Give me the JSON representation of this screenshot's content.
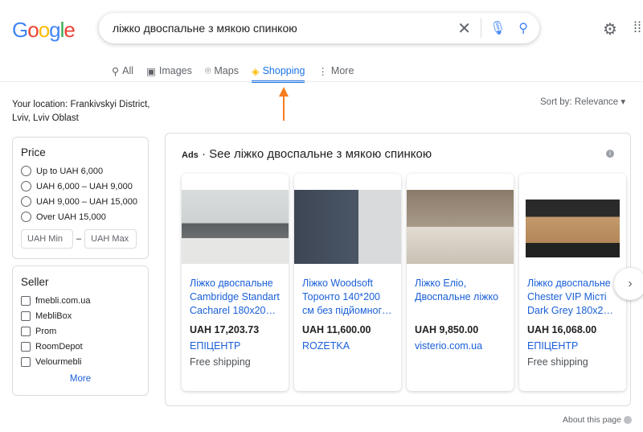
{
  "logo": "Google",
  "search": {
    "query": "ліжко двоспальне з мякою спинкою"
  },
  "tabs": [
    {
      "label": "All",
      "icon": "search-icon"
    },
    {
      "label": "Images",
      "icon": "image-icon"
    },
    {
      "label": "Maps",
      "icon": "map-pin-icon"
    },
    {
      "label": "Shopping",
      "icon": "tag-icon",
      "active": true
    },
    {
      "label": "More",
      "icon": "more-vert-icon"
    }
  ],
  "location": {
    "line1": "Your location: Frankivskyi District,",
    "line2": "Lviv, Lviv Oblast"
  },
  "sort": {
    "label": "Sort by: Relevance"
  },
  "price": {
    "title": "Price",
    "options": [
      "Up to UAH 6,000",
      "UAH 6,000 – UAH 9,000",
      "UAH 9,000 – UAH 15,000",
      "Over UAH 15,000"
    ],
    "min_placeholder": "UAH Min",
    "dash": "–",
    "max_placeholder": "UAH Max"
  },
  "seller": {
    "title": "Seller",
    "options": [
      "fmebli.com.ua",
      "MebliBox",
      "Prom",
      "RoomDepot",
      "Velourmebli"
    ],
    "more": "More"
  },
  "ads": {
    "badge": "Ads",
    "title": "· See ліжко двоспальне з мякою спинкою",
    "info": "i",
    "products": [
      {
        "title": "Ліжко двоспальне Cambridge Standart Cacharel 180x20…",
        "price": "UAH 17,203.73",
        "store": "ЕПІЦЕНТР",
        "shipping": "Free shipping"
      },
      {
        "title": "Ліжко Woodsoft Торонто 140*200 см без підйомног…",
        "price": "UAH 11,600.00",
        "store": "ROZETKA",
        "shipping": ""
      },
      {
        "title": "Ліжко Еліо, Двоспальне ліжко",
        "price": "UAH 9,850.00",
        "store": "visterio.com.ua",
        "shipping": ""
      },
      {
        "title": "Ліжко двоспальне Chester VIP Місті Dark Grey 180x2…",
        "price": "UAH 16,068.00",
        "store": "ЕПІЦЕНТР",
        "shipping": "Free shipping"
      }
    ]
  },
  "about": "About this page",
  "colors": {
    "accent": "#1a73e8",
    "arrow": "#f57c1f"
  }
}
